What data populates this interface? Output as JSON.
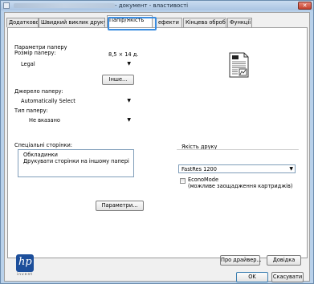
{
  "window": {
    "title": "- документ - властивості",
    "close_label": "✕"
  },
  "tabs": [
    {
      "label": "Додатково"
    },
    {
      "label": "Швидкий виклик друку"
    },
    {
      "label": "Папір/Якість"
    },
    {
      "label": "ефекти"
    },
    {
      "label": "Кінцева обробка"
    },
    {
      "label": "Функції"
    }
  ],
  "paper_options": {
    "section_label": "Параметри паперу",
    "size_label": "Розмір паперу:",
    "size_dims": "8,5 × 14 д.",
    "size_value": "Legal",
    "custom_button": "Інше...",
    "source_label": "Джерело паперу:",
    "source_value": "Automatically Select",
    "type_label": "Тип паперу:",
    "type_value": "Не вказано"
  },
  "special_pages": {
    "label": "Спеціальні сторінки:",
    "items": [
      "Обкладинки",
      "Друкувати сторінки на іншому папері"
    ],
    "settings_button": "Параметри..."
  },
  "print_quality": {
    "label": "Якість друку",
    "value": "FastRes 1200",
    "econo_label": "EconoMode",
    "econo_note": "(можливе заощадження картриджів)"
  },
  "footer": {
    "logo_text": "hp",
    "logo_tag": "invent",
    "about_button": "Про драйвер...",
    "help_button": "Довідка",
    "ok_button": "OK",
    "cancel_button": "Скасувати"
  }
}
